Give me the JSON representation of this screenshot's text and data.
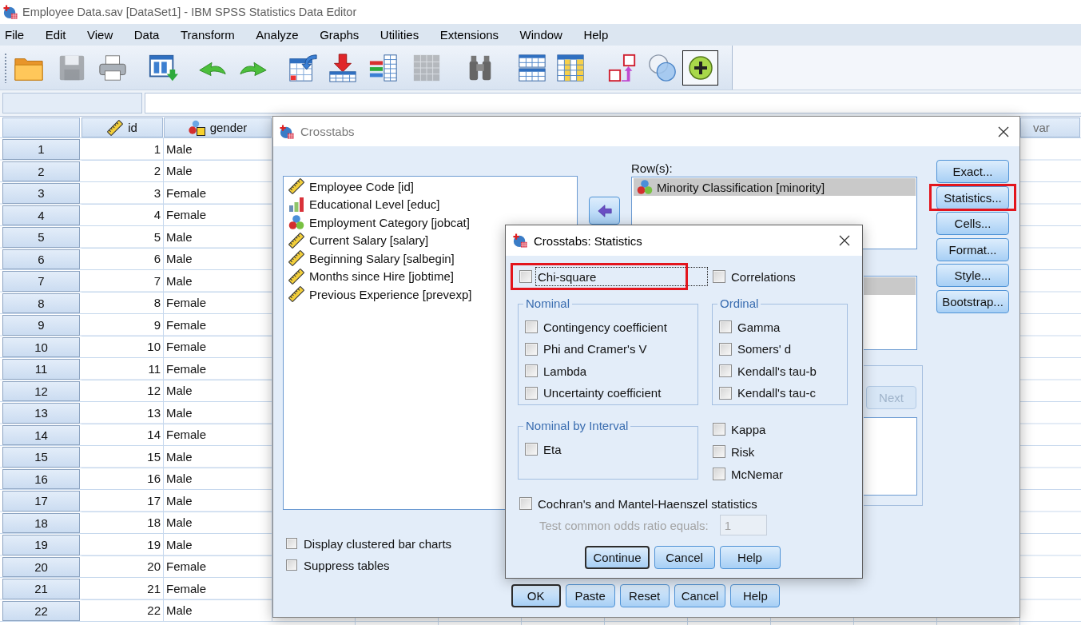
{
  "window": {
    "title": "Employee Data.sav [DataSet1] - IBM SPSS Statistics Data Editor"
  },
  "menu": [
    "File",
    "Edit",
    "View",
    "Data",
    "Transform",
    "Analyze",
    "Graphs",
    "Utilities",
    "Extensions",
    "Window",
    "Help"
  ],
  "toolbar": [
    {
      "disabled": false,
      "on": false
    },
    {
      "disabled": true,
      "on": false
    },
    {
      "disabled": false,
      "on": false
    },
    {
      "disabled": false,
      "on": false
    },
    {
      "disabled": false,
      "on": false
    },
    {
      "disabled": false,
      "on": false
    },
    {
      "disabled": false,
      "on": false
    },
    {
      "disabled": false,
      "on": false
    },
    {
      "disabled": false,
      "on": false
    },
    {
      "disabled": true,
      "on": false
    },
    {
      "disabled": false,
      "on": false
    },
    {
      "disabled": false,
      "on": false
    },
    {
      "disabled": false,
      "on": false
    },
    {
      "disabled": false,
      "on": false
    },
    {
      "disabled": false,
      "on": false
    },
    {
      "disabled": false,
      "on": true
    }
  ],
  "grid": {
    "columns": [
      {
        "label": "id",
        "kind": "scale"
      },
      {
        "label": "gender",
        "kind": "nominal_string"
      },
      {
        "label": "var",
        "kind": "placeholder"
      }
    ],
    "rows": [
      {
        "number": "1",
        "values": [
          "1",
          "Male"
        ]
      },
      {
        "number": "2",
        "values": [
          "2",
          "Male"
        ]
      },
      {
        "number": "3",
        "values": [
          "3",
          "Female"
        ]
      },
      {
        "number": "4",
        "values": [
          "4",
          "Female"
        ]
      },
      {
        "number": "5",
        "values": [
          "5",
          "Male"
        ]
      },
      {
        "number": "6",
        "values": [
          "6",
          "Male"
        ]
      },
      {
        "number": "7",
        "values": [
          "7",
          "Male"
        ]
      },
      {
        "number": "8",
        "values": [
          "8",
          "Female"
        ]
      },
      {
        "number": "9",
        "values": [
          "9",
          "Female"
        ]
      },
      {
        "number": "10",
        "values": [
          "10",
          "Female"
        ]
      },
      {
        "number": "11",
        "values": [
          "11",
          "Female"
        ]
      },
      {
        "number": "12",
        "values": [
          "12",
          "Male"
        ]
      },
      {
        "number": "13",
        "values": [
          "13",
          "Male"
        ]
      },
      {
        "number": "14",
        "values": [
          "14",
          "Female"
        ]
      },
      {
        "number": "15",
        "values": [
          "15",
          "Male"
        ]
      },
      {
        "number": "16",
        "values": [
          "16",
          "Male"
        ]
      },
      {
        "number": "17",
        "values": [
          "17",
          "Male"
        ]
      },
      {
        "number": "18",
        "values": [
          "18",
          "Male"
        ]
      },
      {
        "number": "19",
        "values": [
          "19",
          "Male"
        ]
      },
      {
        "number": "20",
        "values": [
          "20",
          "Female"
        ]
      },
      {
        "number": "21",
        "values": [
          "21",
          "Female"
        ]
      },
      {
        "number": "22",
        "values": [
          "22",
          "Male"
        ]
      }
    ]
  },
  "crosstabs_dialog": {
    "title": "Crosstabs",
    "active": false,
    "variables": [
      {
        "label": "Employee Code [id]",
        "kind": "scale",
        "selected": false
      },
      {
        "label": "Educational Level [educ]",
        "kind": "ordinal",
        "selected": false
      },
      {
        "label": "Employment Category [jobcat]",
        "kind": "nominal",
        "selected": false
      },
      {
        "label": "Current Salary [salary]",
        "kind": "scale",
        "selected": false
      },
      {
        "label": "Beginning Salary [salbegin]",
        "kind": "scale",
        "selected": false
      },
      {
        "label": "Months since Hire [jobtime]",
        "kind": "scale",
        "selected": false
      },
      {
        "label": "Previous Experience [prevexp]",
        "kind": "scale",
        "selected": false
      }
    ],
    "rows_label": "Row(s):",
    "rows": [
      {
        "label": "Minority Classification [minority]",
        "kind": "nominal",
        "selected": true
      }
    ],
    "columns": [
      {
        "selected": true
      }
    ],
    "layer_next": {
      "label": "Next",
      "disabled": true
    },
    "side_buttons": [
      {
        "label": "Exact...",
        "highlighted": false
      },
      {
        "label": "Statistics...",
        "highlighted": true
      },
      {
        "label": "Cells...",
        "highlighted": false
      },
      {
        "label": "Format...",
        "highlighted": false
      },
      {
        "label": "Style...",
        "highlighted": false
      },
      {
        "label": "Bootstrap...",
        "highlighted": false
      }
    ],
    "options": [
      {
        "label": "Display clustered bar charts",
        "checked": false
      },
      {
        "label": "Suppress tables",
        "checked": false
      }
    ],
    "buttons": [
      {
        "label": "OK",
        "default": true
      },
      {
        "label": "Paste",
        "default": false
      },
      {
        "label": "Reset",
        "default": false
      },
      {
        "label": "Cancel",
        "default": false
      },
      {
        "label": "Help",
        "default": false
      }
    ]
  },
  "statistics_dialog": {
    "title": "Crosstabs: Statistics",
    "active": true,
    "top_options": [
      {
        "label": "Chi-square",
        "checked": false,
        "focused": true,
        "highlighted": true
      },
      {
        "label": "Correlations",
        "checked": false,
        "focused": false,
        "highlighted": false
      }
    ],
    "groups": [
      {
        "title": "Nominal",
        "options": [
          {
            "label": "Contingency coefficient",
            "checked": false
          },
          {
            "label": "Phi and Cramer's V",
            "checked": false
          },
          {
            "label": "Lambda",
            "checked": false
          },
          {
            "label": "Uncertainty coefficient",
            "checked": false
          }
        ]
      },
      {
        "title": "Ordinal",
        "options": [
          {
            "label": "Gamma",
            "checked": false
          },
          {
            "label": "Somers' d",
            "checked": false
          },
          {
            "label": "Kendall's tau-b",
            "checked": false
          },
          {
            "label": "Kendall's tau-c",
            "checked": false
          }
        ]
      },
      {
        "title": "Nominal by Interval",
        "options": [
          {
            "label": "Eta",
            "checked": false
          }
        ]
      }
    ],
    "extra_options": [
      {
        "label": "Kappa",
        "checked": false
      },
      {
        "label": "Risk",
        "checked": false
      },
      {
        "label": "McNemar",
        "checked": false
      }
    ],
    "cochran": {
      "label": "Cochran's and Mantel-Haenszel statistics",
      "checked": false
    },
    "odds_ratio": {
      "label": "Test common odds ratio equals:",
      "value": "1",
      "disabled": true
    },
    "buttons": [
      {
        "label": "Continue",
        "default": true
      },
      {
        "label": "Cancel",
        "default": false
      },
      {
        "label": "Help",
        "default": false
      }
    ]
  }
}
